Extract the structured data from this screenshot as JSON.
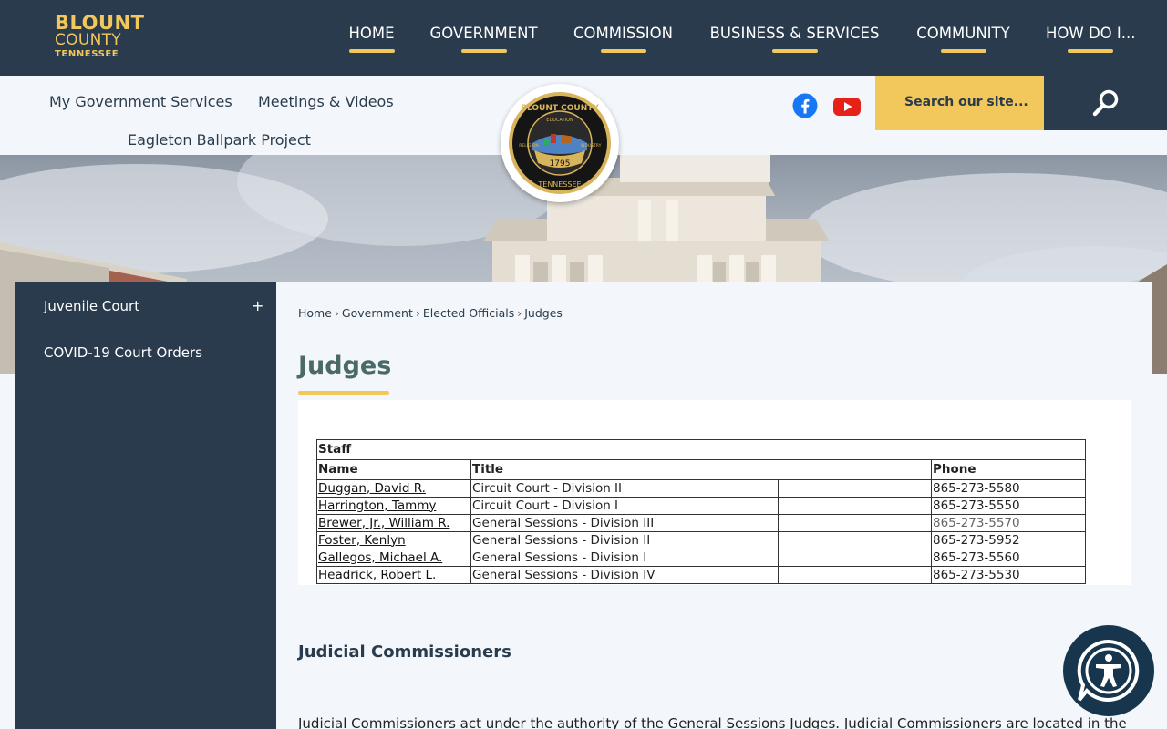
{
  "logo": {
    "line1": "BLOUNT",
    "line2": "COUNTY",
    "line3": "TENNESSEE"
  },
  "nav": {
    "items": [
      {
        "label": "HOME"
      },
      {
        "label": "GOVERNMENT"
      },
      {
        "label": "COMMISSION"
      },
      {
        "label": "BUSINESS & SERVICES"
      },
      {
        "label": "COMMUNITY"
      },
      {
        "label": "HOW DO I..."
      }
    ]
  },
  "subnav": {
    "links": [
      "My Government Services",
      "Meetings & Videos",
      "Eagleton Ballpark Project"
    ]
  },
  "social": {
    "facebook": "facebook-icon",
    "youtube": "youtube-icon"
  },
  "search": {
    "placeholder": "Search our site..."
  },
  "seal": {
    "top": "BLOUNT COUNTY",
    "bottom": "TENNESSEE",
    "year": "1795",
    "left": "RELIGION",
    "right": "INDUSTRY",
    "center": "EDUCATION"
  },
  "sidebar": {
    "items": [
      {
        "label": "Juvenile Court",
        "expand": "+"
      },
      {
        "label": "COVID-19 Court Orders"
      }
    ]
  },
  "breadcrumb": [
    "Home",
    "Government",
    "Elected Officials",
    "Judges"
  ],
  "page": {
    "title": "Judges"
  },
  "staff_table": {
    "caption": "Staff",
    "headers": {
      "name": "Name",
      "title": "Title",
      "phone": "Phone"
    },
    "rows": [
      {
        "name": "Duggan, David R.",
        "title": "Circuit Court - Division II",
        "phone": "865-273-5580"
      },
      {
        "name": "Harrington, Tammy",
        "title": "Circuit Court - Division I",
        "phone": "865-273-5550"
      },
      {
        "name": "Brewer, Jr., William R.",
        "title": "General Sessions - Division III",
        "phone": "865-273-5570"
      },
      {
        "name": "Foster, Kenlyn",
        "title": "General Sessions - Division II",
        "phone": "865-273-5952"
      },
      {
        "name": "Gallegos, Michael A.",
        "title": "General Sessions - Division I",
        "phone": "865-273-5560"
      },
      {
        "name": "Headrick, Robert L.",
        "title": "General Sessions - Division IV",
        "phone": "865-273-5530"
      }
    ]
  },
  "commissioners": {
    "heading": "Judicial Commissioners",
    "text": "Judicial Commissioners act under the authority of the General Sessions Judges.  Judicial Commissioners are located in the"
  },
  "colors": {
    "navy": "#293b4c",
    "gold": "#f2c75c",
    "title": "#4a6a69"
  }
}
